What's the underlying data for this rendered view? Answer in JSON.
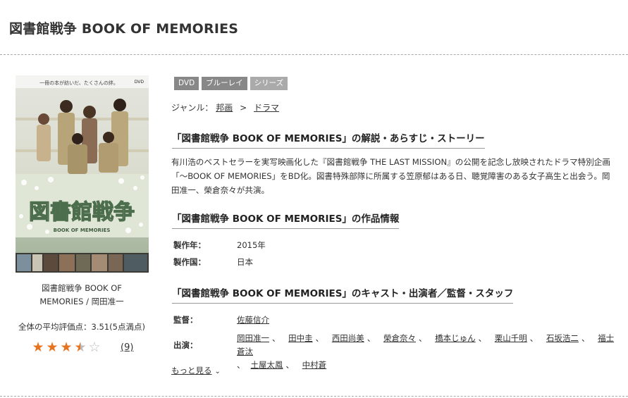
{
  "page": {
    "title": "図書館戦争 BOOK OF MEMORIES"
  },
  "cover": {
    "tagline": "一冊の本が紡いだ、たくさんの絆。",
    "dvd_mark": "DVD",
    "logo_text": "図書館戦争",
    "logo_sub": "BOOK OF MEMORIES",
    "caption_line1": "図書館戦争 BOOK OF",
    "caption_line2": "MEMORIES / 岡田准一"
  },
  "rating": {
    "label": "全体の平均評価点：3.51(5点満点)",
    "value": 3.51,
    "max": 5,
    "count": "(9)"
  },
  "badges": [
    "DVD",
    "ブルーレイ",
    "シリーズ"
  ],
  "genre": {
    "label": "ジャンル：",
    "items": [
      "邦画",
      "ドラマ"
    ],
    "separator": ">"
  },
  "sections": {
    "synopsis_heading": "「図書館戦争 BOOK OF MEMORIES」の解説・あらすじ・ストーリー",
    "synopsis_text": "有川浩のベストセラーを実写映画化した『図書館戦争 THE LAST MISSION』の公開を記念し放映されたドラマ特別企画「～BOOK OF MEMORIES」をBD化。図書特殊部隊に所属する笠原郁はある日、聴覚障害のある女子高生と出会う。岡田准一、榮倉奈々が共演。",
    "info_heading": "「図書館戦争 BOOK OF MEMORIES」の作品情報",
    "cast_heading": "「図書館戦争 BOOK OF MEMORIES」のキャスト・出演者／監督・スタッフ"
  },
  "info": {
    "year_label": "製作年：",
    "year_value": "2015年",
    "country_label": "製作国：",
    "country_value": "日本"
  },
  "staff": {
    "director_label": "監督：",
    "director": "佐藤信介",
    "cast_label": "出演：",
    "cast": [
      "岡田准一",
      "田中圭",
      "西田尚美",
      "榮倉奈々",
      "橋本じゅん",
      "栗山千明",
      "石坂浩二",
      "福士蒼汰",
      "土屋太鳳",
      "中村蒼"
    ],
    "cast_separator": "、",
    "more_label": "もっと見る"
  },
  "colors": {
    "star_on": "#e8731f",
    "star_off": "#bbbbbb",
    "badge": "#888888"
  }
}
